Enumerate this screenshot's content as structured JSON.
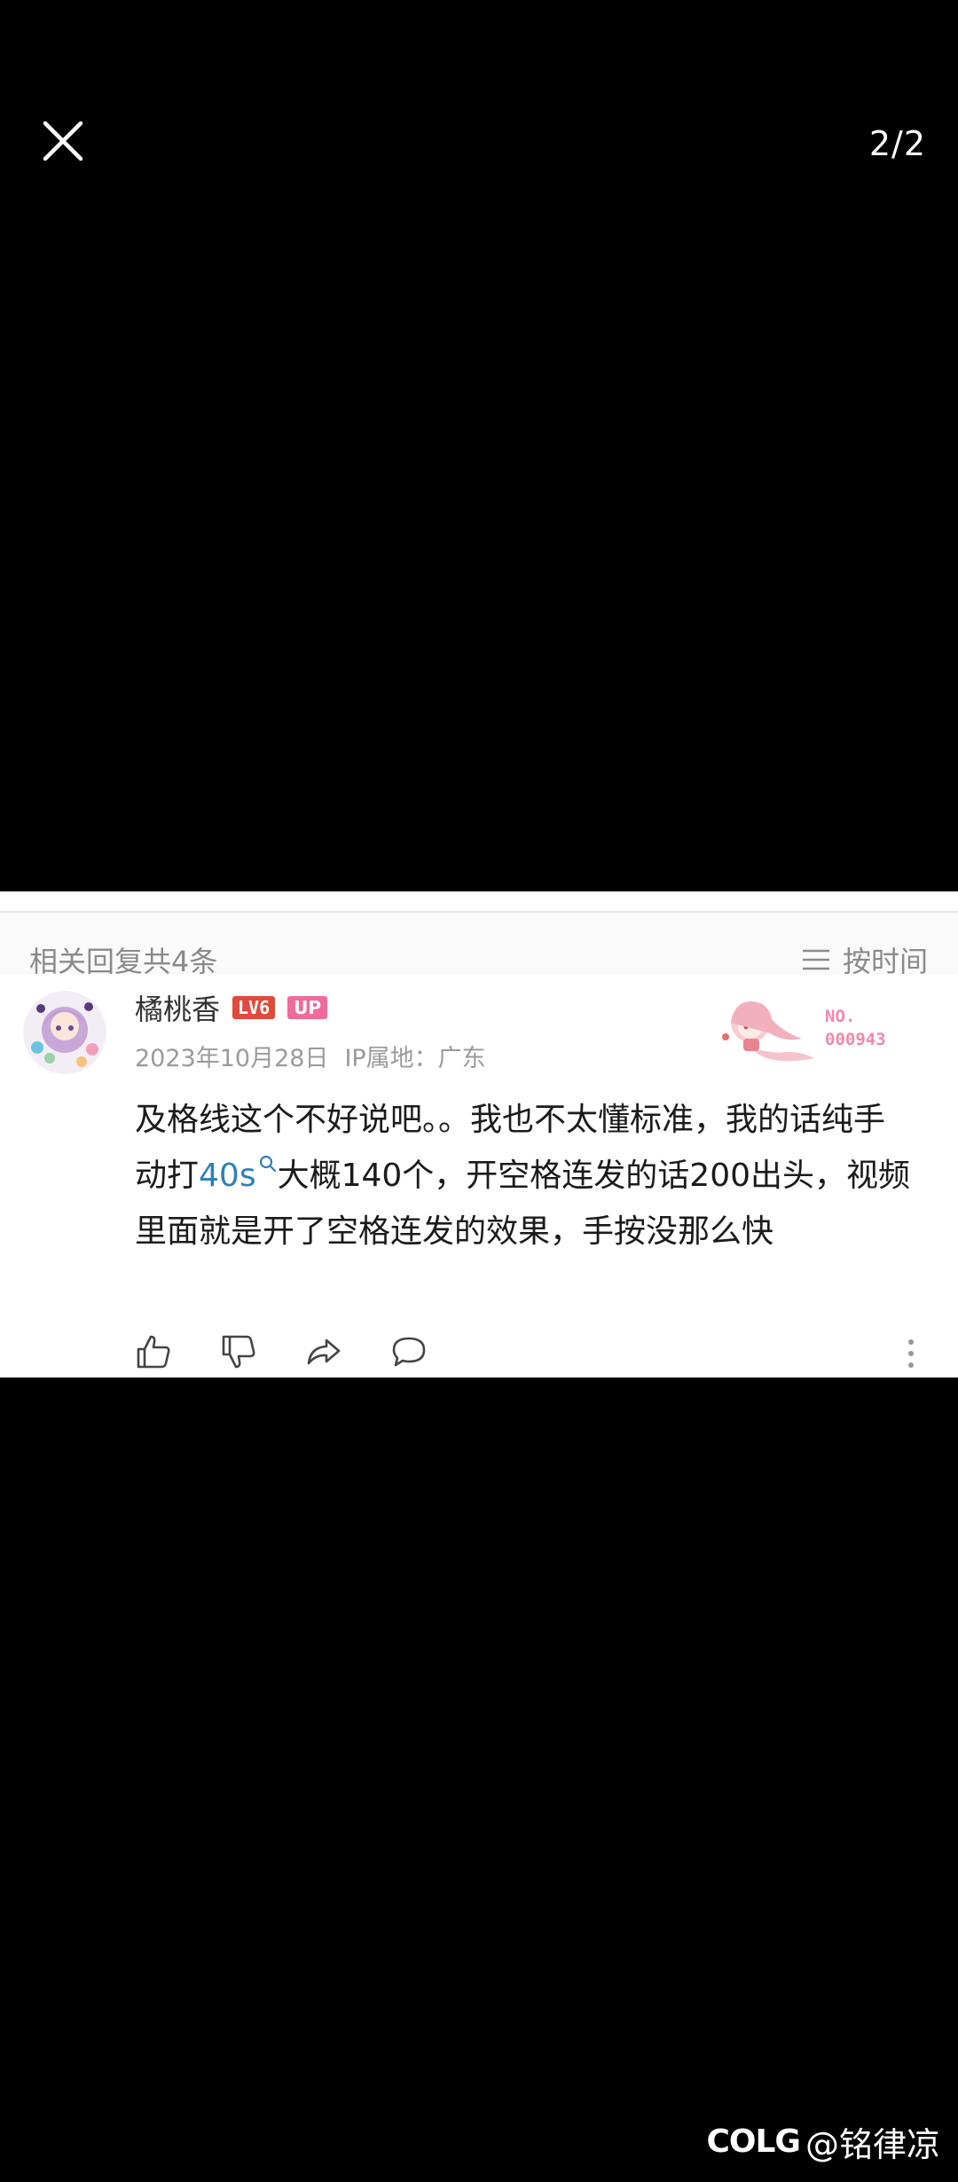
{
  "viewer": {
    "page_indicator": "2/2",
    "close_icon": "close-icon"
  },
  "replies": {
    "header": "相关回复共4条",
    "sort_label": "按时间",
    "sort_icon": "list-lines-icon"
  },
  "comment": {
    "username": "橘桃香",
    "level": "LV6",
    "up_badge": "UP",
    "date": "2023年10月28日",
    "ip_location": "IP属地：广东",
    "fan_card_label": "NO.",
    "fan_card_number": "000943",
    "text_before": "及格线这个不好说吧。。我也不太懂标准，我的话纯手动打",
    "link_text": "40s",
    "text_after": "大概140个，开空格连发的话200出头，视频里面就是开了空格连发的效果，手按没那么快"
  },
  "watermark": {
    "logo": "COLG",
    "handle": "@铭律凉"
  },
  "colors": {
    "background": "#000000",
    "panel": "#ffffff",
    "link": "#2e7fb8",
    "level_badge": "#e04a3c",
    "up_badge": "#f06b9c"
  }
}
